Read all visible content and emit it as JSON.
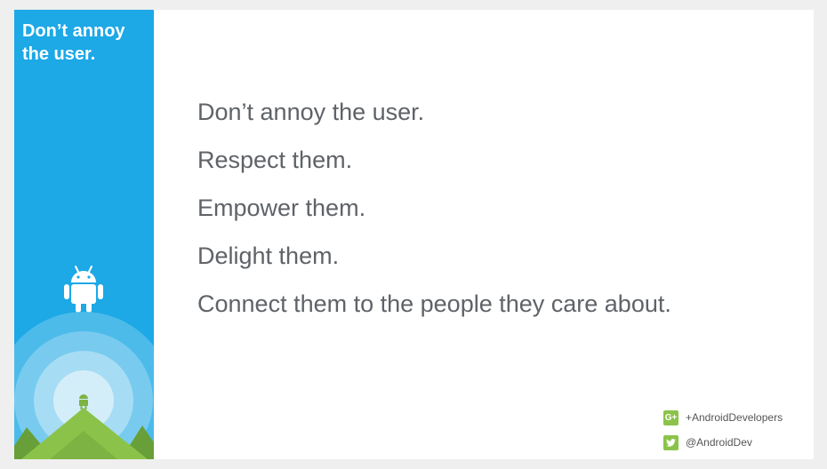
{
  "sidebar": {
    "title_line1": "Don’t annoy",
    "title_line2": "the user.",
    "robot_icon": "android-robot-icon",
    "background": "#1da8e6"
  },
  "bullets": [
    "Don’t annoy the user.",
    "Respect them.",
    "Empower them.",
    "Delight them.",
    "Connect them to the people they care about."
  ],
  "social": {
    "googleplus_icon": "google-plus-icon",
    "googleplus_label": "G+",
    "googleplus": "+AndroidDevelopers",
    "twitter_icon": "twitter-icon",
    "twitter": "@AndroidDev",
    "accent": "#8bc34a"
  }
}
